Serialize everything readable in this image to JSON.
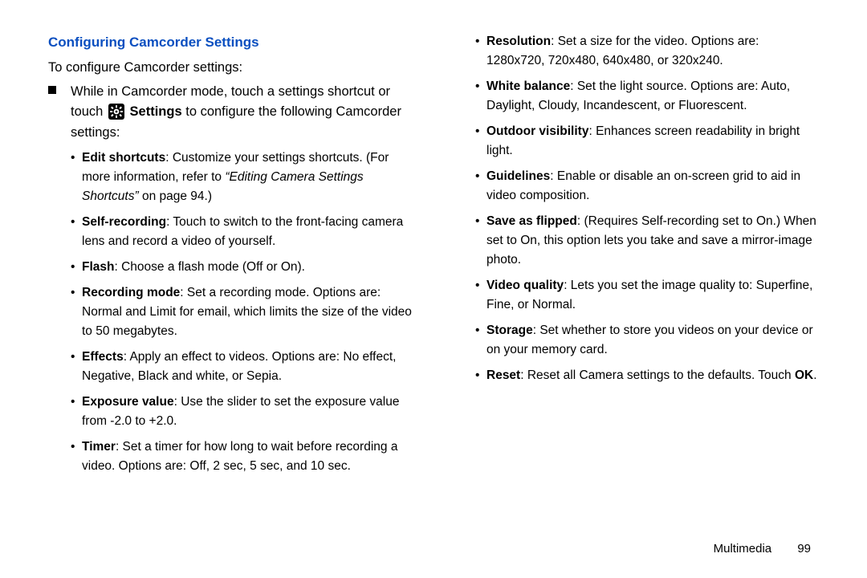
{
  "heading": "Configuring Camcorder Settings",
  "intro": "To configure Camcorder settings:",
  "lvl1_pre": "While in Camcorder mode, touch a settings shortcut or touch ",
  "settings_word": "Settings",
  "lvl1_post": " to configure the following Camcorder settings:",
  "left_items": [
    {
      "b": "Edit shortcuts",
      "t1": ": Customize your settings shortcuts. (For more information, refer to ",
      "i": "“Editing Camera Settings Shortcuts”",
      "t2": " on page 94.)"
    },
    {
      "b": "Self-recording",
      "t1": ": Touch to switch to the front-facing camera lens and record a video of yourself.",
      "i": "",
      "t2": ""
    },
    {
      "b": "Flash",
      "t1": ": Choose a flash mode (Off or On).",
      "i": "",
      "t2": ""
    },
    {
      "b": "Recording mode",
      "t1": ": Set a recording mode. Options are: Normal and Limit for email, which limits the size of the video to 50 megabytes.",
      "i": "",
      "t2": ""
    },
    {
      "b": "Effects",
      "t1": ": Apply an effect to videos. Options are: No effect, Negative, Black and white, or Sepia.",
      "i": "",
      "t2": ""
    },
    {
      "b": "Exposure value",
      "t1": ": Use the slider to set the exposure value from -2.0 to +2.0.",
      "i": "",
      "t2": ""
    },
    {
      "b": "Timer",
      "t1": ": Set a timer for how long to wait before recording a video. Options are: Off, 2 sec, 5 sec, and 10 sec.",
      "i": "",
      "t2": ""
    }
  ],
  "right_items": [
    {
      "b": "Resolution",
      "t1": ": Set a size for the video. Options are: 1280x720, 720x480, 640x480, or 320x240.",
      "b2": "",
      "t2": ""
    },
    {
      "b": "White balance",
      "t1": ": Set the light source. Options are: Auto, Daylight, Cloudy, Incandescent, or Fluorescent.",
      "b2": "",
      "t2": ""
    },
    {
      "b": "Outdoor visibility",
      "t1": ": Enhances screen readability in bright light.",
      "b2": "",
      "t2": ""
    },
    {
      "b": "Guidelines",
      "t1": ": Enable or disable an on-screen grid to aid in video composition.",
      "b2": "",
      "t2": ""
    },
    {
      "b": "Save as flipped",
      "t1": ": (Requires Self-recording set to On.) When set to On, this option lets you take and save a mirror-image photo.",
      "b2": "",
      "t2": ""
    },
    {
      "b": "Video quality",
      "t1": ": Lets you set the image quality to: Superfine, Fine, or Normal.",
      "b2": "",
      "t2": ""
    },
    {
      "b": "Storage",
      "t1": ": Set whether to store you videos on your device or on your memory card.",
      "b2": "",
      "t2": ""
    },
    {
      "b": "Reset",
      "t1": ": Reset all Camera settings to the defaults. Touch ",
      "b2": "OK",
      "t2": "."
    }
  ],
  "footer": {
    "section": "Multimedia",
    "page": "99"
  }
}
